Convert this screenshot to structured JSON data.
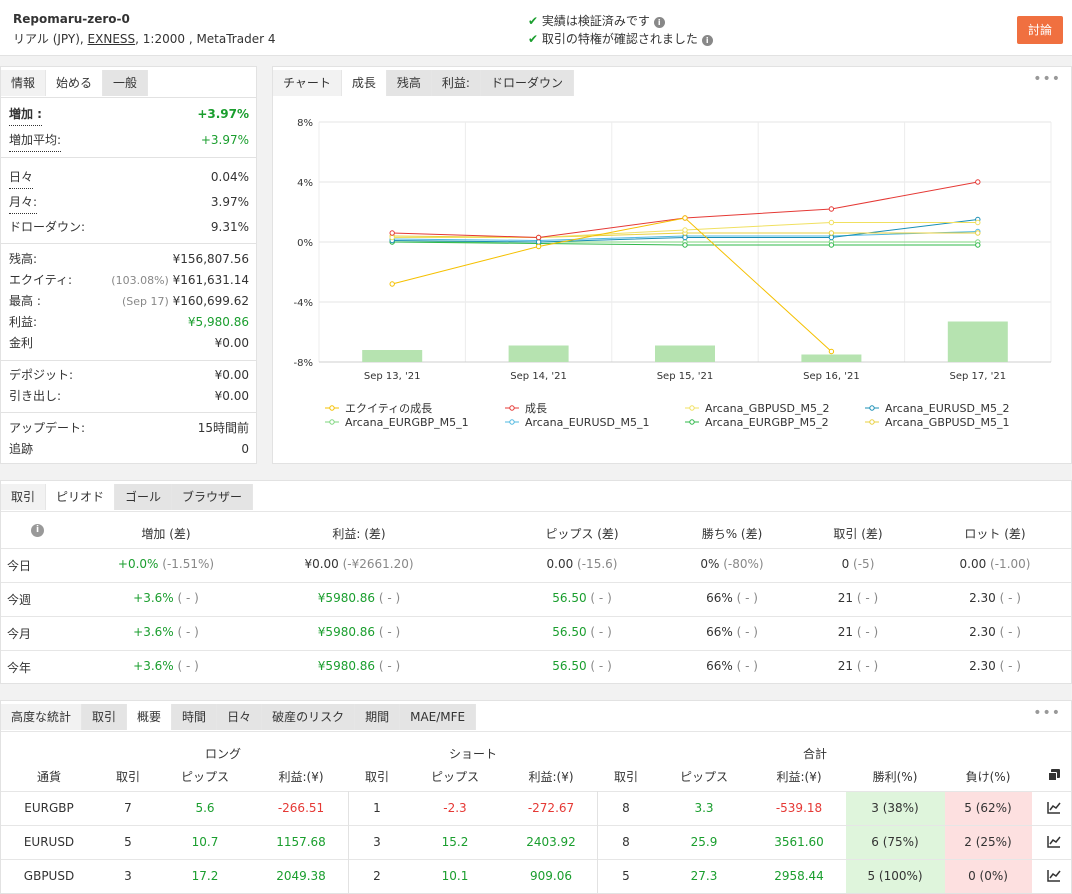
{
  "header": {
    "account_name": "Repomaru-zero-0",
    "account_type": "リアル (JPY),",
    "broker": "EXNESS",
    "details": ", 1:2000 , MetaTrader 4",
    "verify1": "実績は検証済みです",
    "verify2": "取引の特権が確認されました",
    "discuss_button": "討論"
  },
  "left_tabs": [
    "情報",
    "始める",
    "一般"
  ],
  "info": {
    "gain_label": "増加 :",
    "gain_value": "+3.97%",
    "abs_gain_label": "増加平均:",
    "abs_gain_value": "+3.97%",
    "daily_label": "日々",
    "daily_value": "0.04%",
    "monthly_label": "月々:",
    "monthly_value": "3.97%",
    "drawdown_label": "ドローダウン:",
    "drawdown_value": "9.31%",
    "balance_label": "残高:",
    "balance_value": "¥156,807.56",
    "equity_label": "エクイティ:",
    "equity_pct": "(103.08%)",
    "equity_value": "¥161,631.14",
    "highest_label": "最高 :",
    "highest_date": "(Sep 17)",
    "highest_value": "¥160,699.62",
    "profit_label": "利益:",
    "profit_value": "¥5,980.86",
    "interest_label": "金利",
    "interest_value": "¥0.00",
    "deposits_label": "デポジット:",
    "deposits_value": "¥0.00",
    "withdrawals_label": "引き出し:",
    "withdrawals_value": "¥0.00",
    "updated_label": "アップデート:",
    "updated_value": "15時間前",
    "tracking_label": "追跡",
    "tracking_value": "0"
  },
  "chart_tabs": [
    "チャート",
    "成長",
    "残高",
    "利益:",
    "ドローダウン"
  ],
  "chart_data": {
    "type": "line",
    "categories": [
      "Sep 13, '21",
      "Sep 14, '21",
      "Sep 15, '21",
      "Sep 16, '21",
      "Sep 17, '21"
    ],
    "y_ticks": [
      "8%",
      "4%",
      "0%",
      "-4%",
      "-8%"
    ],
    "ylim": [
      -8,
      8
    ],
    "bars": [
      -7.2,
      -6.9,
      -6.9,
      -7.5,
      -5.3
    ],
    "series": [
      {
        "name": "エクイティの成長",
        "color": "#f5c000",
        "values": [
          -2.8,
          -0.3,
          1.6,
          -7.3,
          null
        ]
      },
      {
        "name": "成長",
        "color": "#e53935",
        "values": [
          0.6,
          0.3,
          1.6,
          2.2,
          4.0
        ]
      },
      {
        "name": "Arcana_GBPUSD_M5_2",
        "color": "#f0e060",
        "values": [
          0.3,
          0.3,
          0.8,
          1.3,
          1.3
        ]
      },
      {
        "name": "Arcana_EURUSD_M5_2",
        "color": "#1a8fb5",
        "values": [
          0.1,
          0.0,
          0.3,
          0.3,
          1.5
        ]
      },
      {
        "name": "Arcana_EURGBP_M5_1",
        "color": "#7ed67e",
        "values": [
          0.0,
          0.0,
          0.0,
          0.0,
          0.0
        ]
      },
      {
        "name": "Arcana_EURUSD_M5_1",
        "color": "#4fb8e0",
        "values": [
          0.2,
          0.1,
          0.4,
          0.4,
          0.7
        ]
      },
      {
        "name": "Arcana_EURGBP_M5_2",
        "color": "#2fb84a",
        "values": [
          0.0,
          -0.1,
          -0.2,
          -0.2,
          -0.2
        ]
      },
      {
        "name": "Arcana_GBPUSD_M5_1",
        "color": "#e8d040",
        "values": [
          0.4,
          0.3,
          0.6,
          0.6,
          0.6
        ]
      }
    ],
    "bar_color": "#b6e3b0"
  },
  "period_tabs": [
    "取引",
    "ピリオド",
    "ゴール",
    "ブラウザー"
  ],
  "period": {
    "headers": [
      "増加 (差)",
      "利益: (差)",
      "ピップス (差)",
      "勝ち% (差)",
      "取引 (差)",
      "ロット (差)"
    ],
    "rows": [
      {
        "label": "今日",
        "cells": [
          [
            "+0.0%",
            "(-1.51%)"
          ],
          [
            "¥0.00",
            "(-¥2661.20)"
          ],
          [
            "0.00",
            "(-15.6)"
          ],
          [
            "0%",
            "(-80%)"
          ],
          [
            "0",
            "(-5)"
          ],
          [
            "0.00",
            "(-1.00)"
          ]
        ]
      },
      {
        "label": "今週",
        "cells": [
          [
            "+3.6%",
            "( - )"
          ],
          [
            "¥5980.86",
            "( - )"
          ],
          [
            "56.50",
            "( - )"
          ],
          [
            "66%",
            "( - )"
          ],
          [
            "21",
            "( - )"
          ],
          [
            "2.30",
            "( - )"
          ]
        ]
      },
      {
        "label": "今月",
        "cells": [
          [
            "+3.6%",
            "( - )"
          ],
          [
            "¥5980.86",
            "( - )"
          ],
          [
            "56.50",
            "( - )"
          ],
          [
            "66%",
            "( - )"
          ],
          [
            "21",
            "( - )"
          ],
          [
            "2.30",
            "( - )"
          ]
        ]
      },
      {
        "label": "今年",
        "cells": [
          [
            "+3.6%",
            "( - )"
          ],
          [
            "¥5980.86",
            "( - )"
          ],
          [
            "56.50",
            "( - )"
          ],
          [
            "66%",
            "( - )"
          ],
          [
            "21",
            "( - )"
          ],
          [
            "2.30",
            "( - )"
          ]
        ]
      }
    ]
  },
  "stats_tabs": [
    "高度な統計",
    "取引",
    "概要",
    "時間",
    "日々",
    "破産のリスク",
    "期間",
    "MAE/MFE"
  ],
  "stats": {
    "group_long": "ロング",
    "group_short": "ショート",
    "group_total": "合計",
    "headers": [
      "通貨",
      "取引",
      "ピップス",
      "利益:(¥)",
      "取引",
      "ピップス",
      "利益:(¥)",
      "取引",
      "ピップス",
      "利益:(¥)",
      "勝利(%)",
      "負け(%)"
    ],
    "rows": [
      [
        "EURGBP",
        "7",
        "5.6",
        "-266.51",
        "1",
        "-2.3",
        "-272.67",
        "8",
        "3.3",
        "-539.18",
        "3 (38%)",
        "5 (62%)"
      ],
      [
        "EURUSD",
        "5",
        "10.7",
        "1157.68",
        "3",
        "15.2",
        "2403.92",
        "8",
        "25.9",
        "3561.60",
        "6 (75%)",
        "2 (25%)"
      ],
      [
        "GBPUSD",
        "3",
        "17.2",
        "2049.38",
        "2",
        "10.1",
        "909.06",
        "5",
        "27.3",
        "2958.44",
        "5 (100%)",
        "0 (0%)"
      ]
    ]
  }
}
